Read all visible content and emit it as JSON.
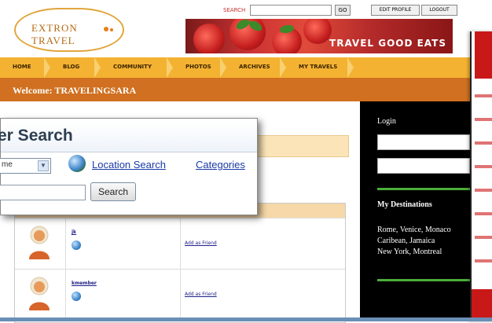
{
  "site": {
    "logo_text": "EXTRON TRAVEL",
    "search_label": "SEARCH",
    "search_go": "GO",
    "edit_profile": "EDIT PROFILE",
    "logout": "LOGOUT",
    "banner_text": "TRAVEL GOOD EATS",
    "nav": [
      "HOME",
      "BLOG",
      "COMMUNITY",
      "PHOTOS",
      "ARCHIVES",
      "MY TRAVELS"
    ],
    "welcome": "Welcome: TRAVELINGSARA"
  },
  "sidebar": {
    "login_label": "Login",
    "destinations_title": "My Destinations",
    "destinations": [
      "Rome, Venice, Monaco",
      "Caribean, Jamaica",
      "New York, Montreal"
    ]
  },
  "results": {
    "rows": [
      {
        "username": "jk",
        "action": "Add as Friend"
      },
      {
        "username": "kmember",
        "action": "Add as Friend"
      }
    ]
  },
  "overlay": {
    "title": "er Search",
    "select_value": "me",
    "location_link": "Location Search",
    "categories_link": "Categories",
    "search_button": "Search"
  },
  "colors": {
    "nav_bg": "#f4b232",
    "welcome_bg": "#d07020",
    "link": "#1a3aa8",
    "sidebar_bg": "#000000",
    "accent_green": "#4caf3a"
  }
}
